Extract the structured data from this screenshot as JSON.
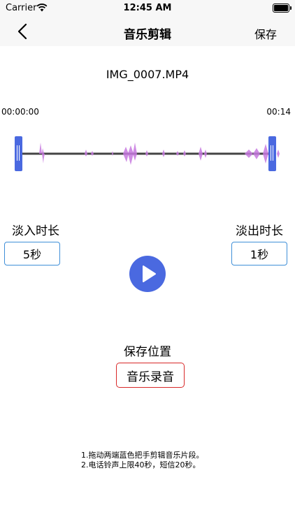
{
  "status_bar": {
    "carrier": "Carrier",
    "time": "12:45 AM",
    "wifi_icon": "wifi-icon",
    "battery_icon": "battery-icon"
  },
  "nav": {
    "back_icon": "chevron-left-icon",
    "title": "音乐剪辑",
    "save_label": "保存"
  },
  "file": {
    "name": "IMG_0007.MP4"
  },
  "timeline": {
    "start_time": "00:00:00",
    "end_time": "00:14"
  },
  "fade_in": {
    "label": "淡入时长",
    "value": "5秒"
  },
  "fade_out": {
    "label": "淡出时长",
    "value": "1秒"
  },
  "player": {
    "play_icon": "play-icon"
  },
  "save_location": {
    "label": "保存位置",
    "value": "音乐录音"
  },
  "instructions": [
    "1.拖动两端蓝色把手剪辑音乐片段。",
    "2.电话铃声上限40秒，短信20秒。"
  ],
  "colors": {
    "accent_blue": "#4a69e0",
    "field_border": "#3f8fd8",
    "save_location_border": "#d82828",
    "waveform": "#c77ae0",
    "bar_background": "#f7f7f7"
  }
}
